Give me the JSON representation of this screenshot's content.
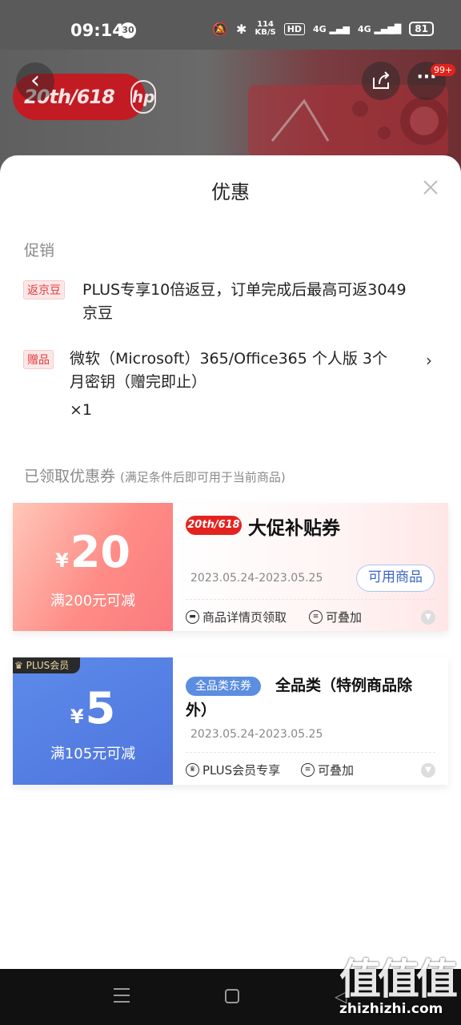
{
  "status_bar": {
    "time": "09:14",
    "notification_count": "30",
    "net_speed_value": "114",
    "net_speed_unit": "KB/S",
    "hd_label": "HD",
    "signal_1": "4G",
    "signal_2": "4G",
    "battery": "81"
  },
  "background_page": {
    "brand_event": "20th/618",
    "brand_logo_text": "hp",
    "message_count": "99+"
  },
  "sheet": {
    "title": "优惠",
    "promotions_header": "促销",
    "promotions": [
      {
        "tag": "返京豆",
        "text_line1": "PLUS专享10倍返豆，订单完成后最高可返3049",
        "text_line2": "京豆"
      },
      {
        "tag": "赠品",
        "text_line1": "微软（Microsoft）365/Office365 个人版 3个",
        "text_line2": "月密钥（赠完即止）",
        "qty": "×1"
      }
    ],
    "coupons_header": "已领取优惠券",
    "coupons_subheader": "(满足条件后即可用于当前商品)",
    "coupons": [
      {
        "currency": "¥",
        "amount": "20",
        "condition": "满200元可减",
        "event_tag": "20th/618",
        "title": "大促补贴券",
        "date_range": "2023.05.24-2023.05.25",
        "button_label": "可用商品",
        "source": "商品详情页领取",
        "stackable": "可叠加"
      },
      {
        "member_tag": "PLUS会员",
        "currency": "¥",
        "amount": "5",
        "condition": "满105元可减",
        "type_tag": "全品类东券",
        "title": "全品类（特例商品除外）",
        "date_range": "2023.05.24-2023.05.25",
        "source": "PLUS会员专享",
        "stackable": "可叠加"
      }
    ]
  },
  "watermark": {
    "big": "值值值",
    "site": "zhizhizhi.com"
  },
  "colors": {
    "jd_red": "#e4393c",
    "coupon_red": "#fb7a7e",
    "coupon_blue": "#4f74dd"
  }
}
